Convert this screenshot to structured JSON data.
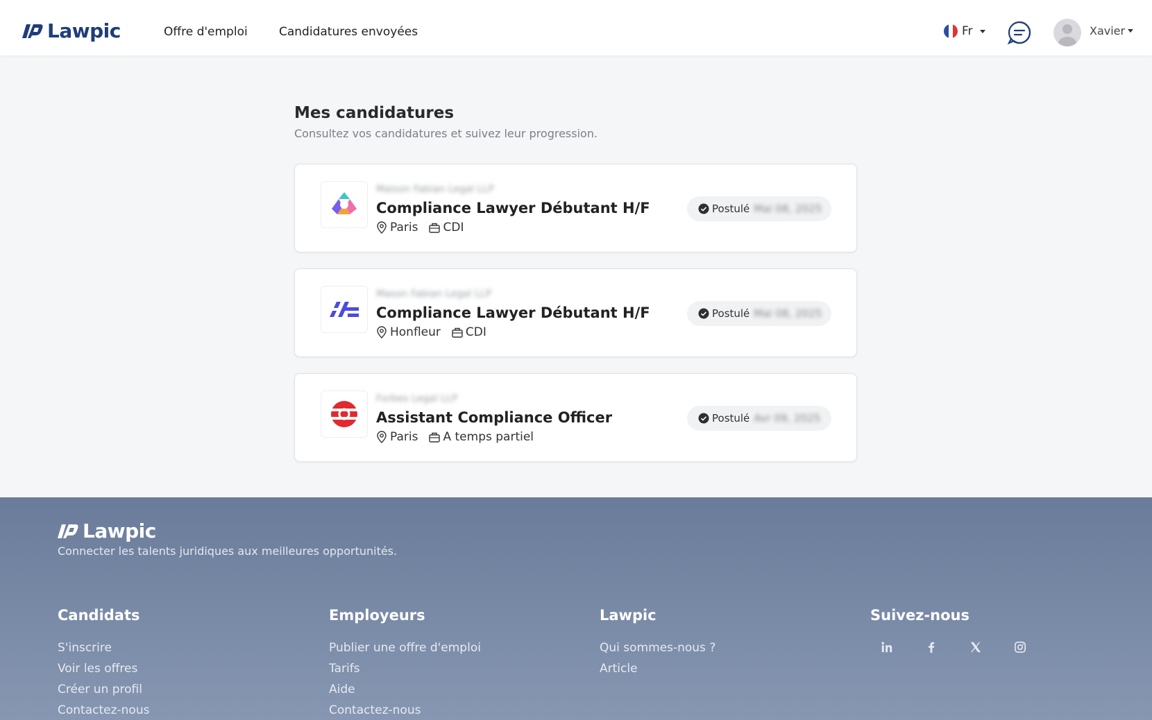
{
  "header": {
    "logo_text": "Lawpic",
    "nav": [
      "Offre d'emploi",
      "Candidatures envoyées"
    ],
    "lang": "Fr",
    "user_name": "Xavier"
  },
  "main": {
    "title": "Mes candidatures",
    "subtitle": "Consultez vos candidatures et suivez leur progression.",
    "applications": [
      {
        "company": "Maison Fabian Legal LLP",
        "title": "Compliance Lawyer Débutant H/F",
        "location": "Paris",
        "contract": "CDI",
        "status": "Postulé",
        "date": "Mai 08, 2025"
      },
      {
        "company": "Mason Fabian Legal LLP",
        "title": "Compliance Lawyer Débutant H/F",
        "location": "Honfleur",
        "contract": "CDI",
        "status": "Postulé",
        "date": "Mai 08, 2025"
      },
      {
        "company": "Forbes Legal LLP",
        "title": "Assistant Compliance Officer",
        "location": "Paris",
        "contract": "A temps partiel",
        "status": "Postulé",
        "date": "Avr 09, 2025"
      }
    ]
  },
  "footer": {
    "logo_text": "Lawpic",
    "tagline": "Connecter les talents juridiques aux meilleures opportunités.",
    "columns": [
      {
        "title": "Candidats",
        "links": [
          "S'inscrire",
          "Voir les offres",
          "Créer un profil",
          "Contactez-nous"
        ]
      },
      {
        "title": "Employeurs",
        "links": [
          "Publier une offre d'emploi",
          "Tarifs",
          "Aide",
          "Contactez-nous"
        ]
      },
      {
        "title": "Lawpic",
        "links": [
          "Qui sommes-nous ?",
          "Article"
        ]
      },
      {
        "title": "Suivez-nous",
        "socials": [
          "linkedin-icon",
          "facebook-icon",
          "x-icon",
          "instagram-icon"
        ]
      }
    ]
  },
  "colors": {
    "brand": "#1e3d7a",
    "footer": "#6a7c9a",
    "card_border": "#dfe1e5"
  }
}
